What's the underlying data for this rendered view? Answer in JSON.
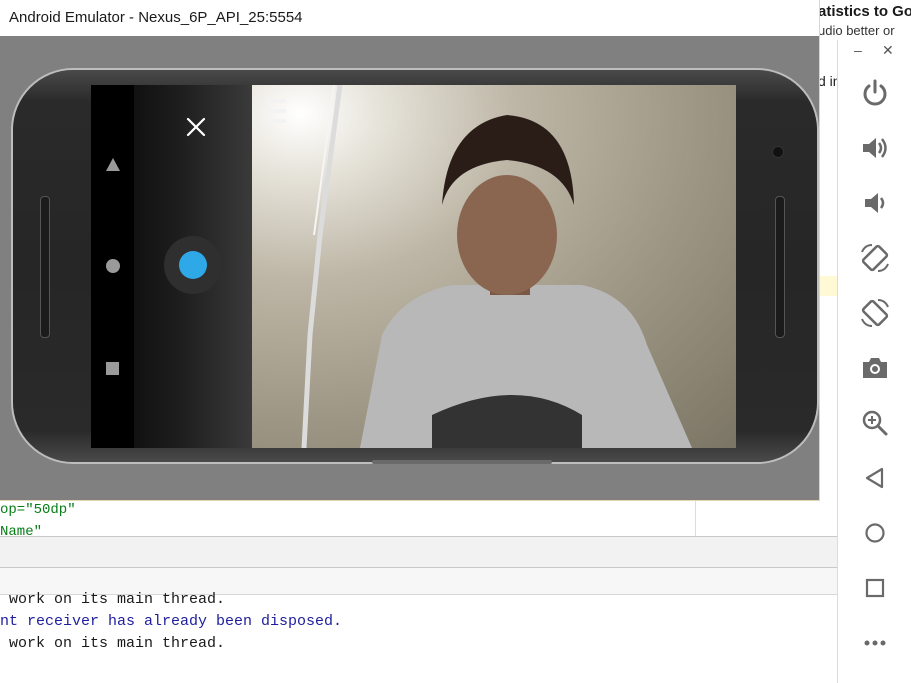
{
  "emulator": {
    "title": "Android Emulator - Nexus_6P_API_25:5554"
  },
  "code_lines": [
    "op=\"50dp\"",
    "Name\""
  ],
  "log_lines": [
    " work on its main thread.",
    "nt receiver has already been disposed.",
    " work on its main thread."
  ],
  "browser_fragment": {
    "title": "atistics to Go",
    "subtitle": "udio better or",
    "side_text": "d in"
  },
  "colors": {
    "shutter": "#2fa8e8",
    "log_black": "#1a1a1a",
    "log_blue": "#1e1e9e",
    "code_green": "#067d17"
  },
  "toolbar": {
    "icons": [
      "power-icon",
      "volume-up-icon",
      "volume-down-icon",
      "rotate-left-icon",
      "rotate-right-icon",
      "camera-icon",
      "zoom-icon",
      "back-icon",
      "home-icon",
      "overview-icon",
      "more-icon"
    ]
  }
}
